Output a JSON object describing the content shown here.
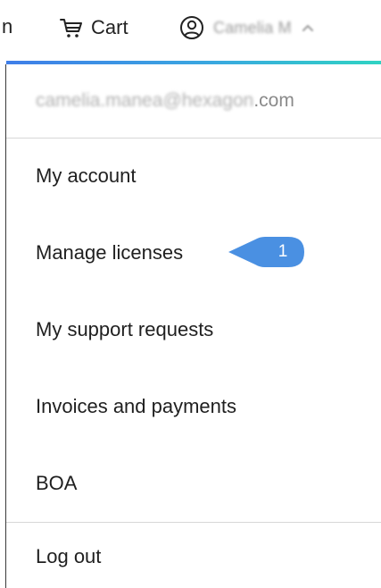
{
  "header": {
    "cut_text": "n",
    "cart_label": "Cart",
    "user_name": "Camelia M"
  },
  "dropdown": {
    "email_visible_prefix": "camelia.manea@hexagon",
    "email_visible_suffix": ".com",
    "items": [
      {
        "label": "My account"
      },
      {
        "label": "Manage licenses"
      },
      {
        "label": "My support requests"
      },
      {
        "label": "Invoices and payments"
      },
      {
        "label": "BOA"
      }
    ],
    "logout_label": "Log out"
  },
  "callout": {
    "number": "1",
    "color": "#4a90e2"
  },
  "colors": {
    "accent_start": "#3f7ee8",
    "accent_end": "#2fd3c3",
    "text": "#1f1f1f",
    "muted_text": "#8a8a8a",
    "divider": "#d7d7d7"
  },
  "icons": {
    "cart": "cart-icon",
    "user": "user-icon",
    "chevron": "chevron-up-icon"
  }
}
